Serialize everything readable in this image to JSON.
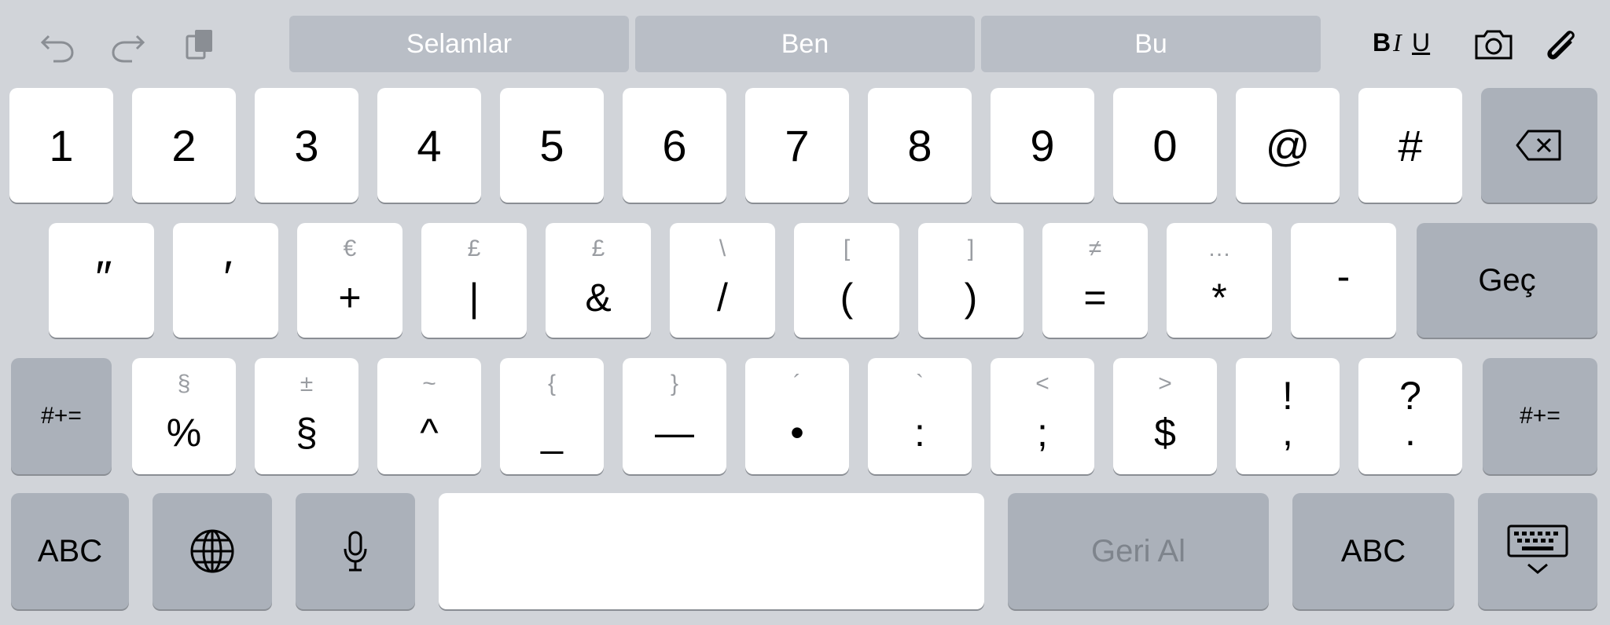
{
  "toolbar": {
    "undo_icon": "undo-icon",
    "redo_icon": "redo-icon",
    "paste_icon": "clipboard-icon",
    "suggestions": [
      "Selamlar",
      "Ben",
      "Bu"
    ],
    "format": {
      "bold": "B",
      "italic": "I",
      "underline": "U"
    },
    "camera_icon": "camera-icon",
    "attach_icon": "paperclip-icon"
  },
  "row1": {
    "keys": [
      "1",
      "2",
      "3",
      "4",
      "5",
      "6",
      "7",
      "8",
      "9",
      "0",
      "@",
      "#"
    ],
    "delete_icon": "backspace-icon"
  },
  "row2": {
    "keys": [
      {
        "main": "″",
        "alt": ""
      },
      {
        "main": "′",
        "alt": ""
      },
      {
        "main": "+",
        "alt": "€"
      },
      {
        "main": "|",
        "alt": "£"
      },
      {
        "main": "&",
        "alt": "£"
      },
      {
        "main": "/",
        "alt": "\\"
      },
      {
        "main": "(",
        "alt": "["
      },
      {
        "main": ")",
        "alt": "]"
      },
      {
        "main": "=",
        "alt": "≠"
      },
      {
        "main": "*",
        "alt": "…"
      },
      {
        "main": "-",
        "alt": ""
      }
    ],
    "return_label": "Geç"
  },
  "row3": {
    "shift_label": "#+=",
    "keys": [
      {
        "main": "%",
        "alt": "§"
      },
      {
        "main": "§",
        "alt": "±"
      },
      {
        "main": "^",
        "alt": "~"
      },
      {
        "main": "_",
        "alt": "{"
      },
      {
        "main": "—",
        "alt": "}"
      },
      {
        "main": "•",
        "alt": "´"
      },
      {
        "main": ":",
        "alt": "`"
      },
      {
        "main": ";",
        "alt": "<"
      },
      {
        "main": "$",
        "alt": ">"
      },
      {
        "main": "!",
        "alt": "",
        "sub": ","
      },
      {
        "main": "?",
        "alt": "",
        "sub": "."
      }
    ],
    "shift_right_label": "#+="
  },
  "row4": {
    "abc_left": "ABC",
    "globe_icon": "globe-icon",
    "mic_icon": "microphone-icon",
    "space_label": "",
    "undo_label": "Geri Al",
    "abc_right": "ABC",
    "hide_icon": "keyboard-hide-icon"
  }
}
